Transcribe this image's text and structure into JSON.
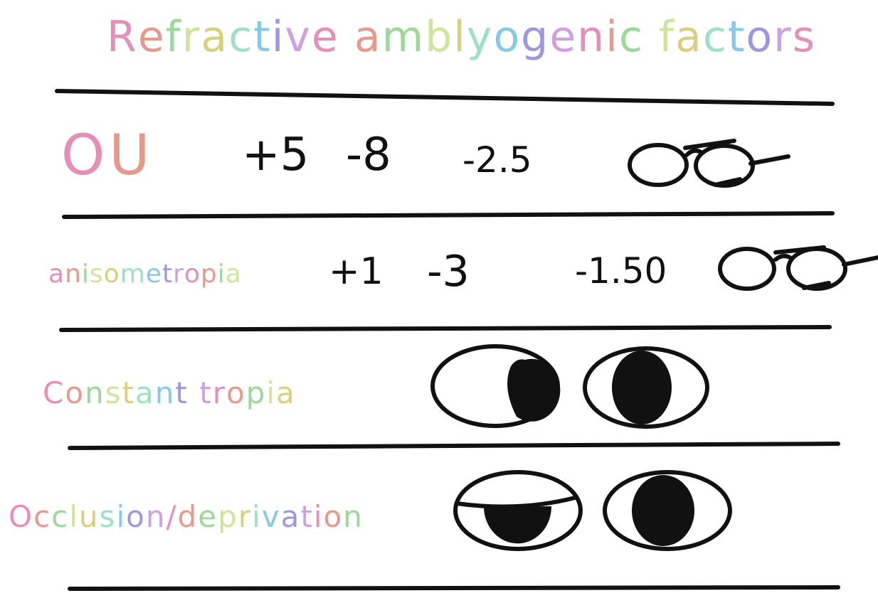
{
  "title": "Refractive amblyogenic factors",
  "rows": [
    {
      "label": "OU",
      "values": [
        "+5",
        "-8",
        "-2.5"
      ],
      "icon": "glasses-icon"
    },
    {
      "label": "anisometropia",
      "values": [
        "+1",
        "-3",
        "-1.50"
      ],
      "icon": "glasses-icon"
    },
    {
      "label": "Constant tropia",
      "icons": [
        "deviated-eye-icon",
        "eye-icon"
      ]
    },
    {
      "label": "Occlusion/deprivation",
      "icons": [
        "droopy-eyelid-eye-icon",
        "eye-icon"
      ]
    }
  ],
  "palette": [
    "#e58fb8",
    "#e59a8c",
    "#9bd89a",
    "#cfe59a",
    "#d9d07f",
    "#9fe0c5",
    "#86c9e6",
    "#9f96e0",
    "#cf9fe0"
  ]
}
